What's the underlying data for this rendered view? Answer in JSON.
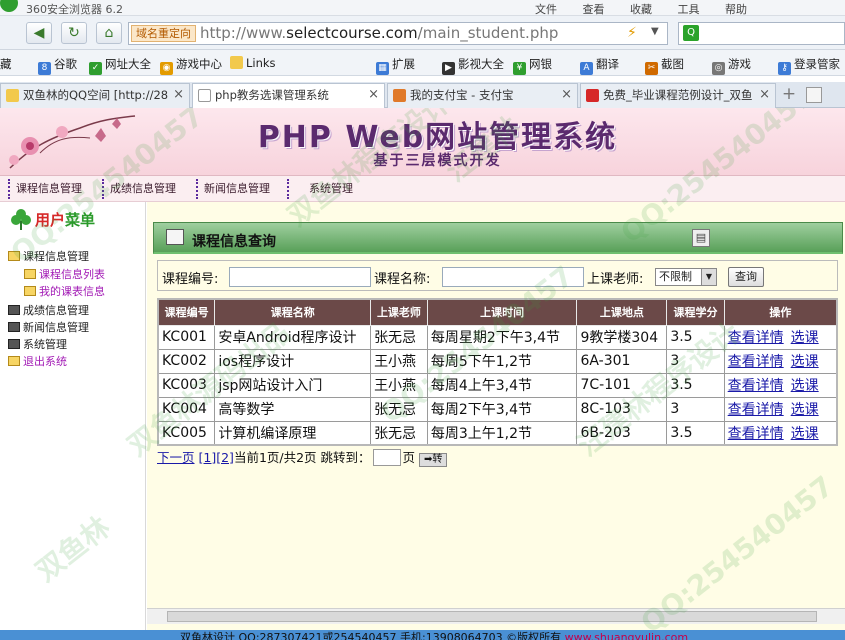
{
  "browser": {
    "title": "360安全浏览器 6.2",
    "menus": [
      "文件",
      "查看",
      "收藏",
      "工具",
      "帮助"
    ],
    "redirect_tag": "域名重定向",
    "url_prefix": "http://www.",
    "url_domain": "selectcourse.com",
    "url_path": "/main_student.php",
    "bookmarks": [
      "藏",
      "谷歌",
      "网址大全",
      "游戏中心",
      "Links",
      "扩展",
      "影视大全",
      "网银",
      "翻译",
      "截图",
      "游戏",
      "登录管家"
    ],
    "tabs": [
      {
        "label": "双鱼林的QQ空间 [http://28",
        "active": false
      },
      {
        "label": "php教务选课管理系统",
        "active": true
      },
      {
        "label": "我的支付宝 - 支付宝",
        "active": false
      },
      {
        "label": "免费_毕业课程范例设计_双鱼",
        "active": false
      }
    ]
  },
  "banner": {
    "title": "PHP Web网站管理系统",
    "subtitle": "基于三层模式开发"
  },
  "topnav": [
    "课程信息管理",
    "成绩信息管理",
    "新闻信息管理",
    "系统管理"
  ],
  "sidebar": {
    "header_red": "用户",
    "header_green": "菜单",
    "items": [
      {
        "label": "课程信息管理"
      },
      {
        "label": "课程信息列表"
      },
      {
        "label": "我的课表信息"
      },
      {
        "label": "成绩信息管理"
      },
      {
        "label": "新闻信息管理"
      },
      {
        "label": "系统管理"
      },
      {
        "label": "退出系统"
      }
    ]
  },
  "panel": {
    "title": "课程信息查询"
  },
  "search": {
    "course_no_label": "课程编号:",
    "course_name_label": "课程名称:",
    "teacher_label": "上课老师:",
    "teacher_value": "不限制",
    "query_button": "查询"
  },
  "table": {
    "headers": [
      "课程编号",
      "课程名称",
      "上课老师",
      "上课时间",
      "上课地点",
      "课程学分",
      "操作"
    ],
    "rows": [
      {
        "id": "KC001",
        "name": "安卓Android程序设计",
        "teacher": "张无忌",
        "time": "每周星期2下午3,4节",
        "place": "9教学楼304",
        "credit": "3.5"
      },
      {
        "id": "KC002",
        "name": "ios程序设计",
        "teacher": "王小燕",
        "time": "每周5下午1,2节",
        "place": "6A-301",
        "credit": "3"
      },
      {
        "id": "KC003",
        "name": "jsp网站设计入门",
        "teacher": "王小燕",
        "time": "每周4上午3,4节",
        "place": "7C-101",
        "credit": "3.5"
      },
      {
        "id": "KC004",
        "name": "高等数学",
        "teacher": "张无忌",
        "time": "每周2下午3,4节",
        "place": "8C-103",
        "credit": "3"
      },
      {
        "id": "KC005",
        "name": "计算机编译原理",
        "teacher": "张无忌",
        "time": "每周3上午1,2节",
        "place": "6B-203",
        "credit": "3.5"
      }
    ],
    "action_detail": "查看详情",
    "action_select": "选课"
  },
  "pager": {
    "next": "下一页",
    "page1": "[1]",
    "page2": "[2]",
    "info": "当前1页/共2页 跳转到：",
    "suffix": "页",
    "go": "➡转"
  },
  "footer": {
    "text": "双鱼林设计 QQ:287307421或254540457 手机:13908064703 ©版权所有 ",
    "link": "www.shuangyulin.com"
  },
  "watermarks": [
    "QQ:254540457",
    "双鱼林程序设计",
    "汪建林",
    "QQ:254540457",
    "双鱼林源码出品",
    "QQ:254540457",
    "汪建林程序设计",
    "双鱼林",
    "QQ:254540457"
  ]
}
